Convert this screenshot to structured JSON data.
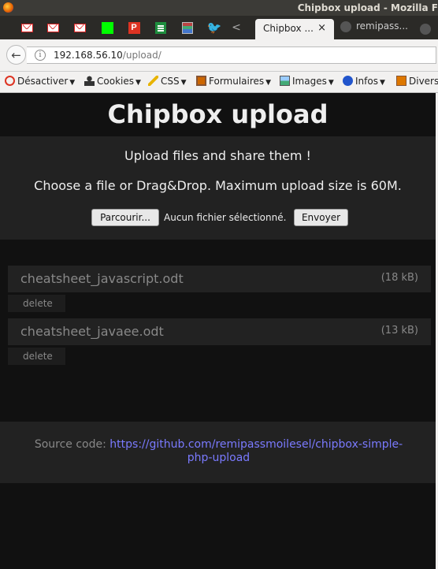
{
  "window": {
    "title": "Chipbox upload - Mozilla F"
  },
  "tabs": {
    "active": {
      "label": "Chipbox ...",
      "close": "×"
    },
    "second": {
      "label": "remipass..."
    },
    "overflow": "<"
  },
  "navbar": {
    "back": "←",
    "host": "192.168.56.10",
    "path": "/upload/",
    "info": "i"
  },
  "toolbar": [
    {
      "label": "Désactiver",
      "icon": "forbidden-icon",
      "color": "#d32"
    },
    {
      "label": "Cookies",
      "icon": "person-icon",
      "color": "#333"
    },
    {
      "label": "CSS",
      "icon": "pencil-icon",
      "color": "#e8b400"
    },
    {
      "label": "Formulaires",
      "icon": "clipboard-icon",
      "color": "#c60"
    },
    {
      "label": "Images",
      "icon": "image-icon",
      "color": "#4a7"
    },
    {
      "label": "Infos",
      "icon": "info-icon",
      "color": "#25c"
    },
    {
      "label": "Divers",
      "icon": "book-icon",
      "color": "#d70"
    }
  ],
  "page": {
    "heading": "Chipbox upload",
    "upload": {
      "line1": "Upload files and share them !",
      "line2": "Choose a file or Drag&Drop. Maximum upload size is 60M.",
      "browse": "Parcourir...",
      "no_file": "Aucun fichier sélectionné.",
      "submit": "Envoyer"
    },
    "files": [
      {
        "name": "cheatsheet_javascript.odt",
        "size": "(18 kB)",
        "delete": "delete"
      },
      {
        "name": "cheatsheet_javaee.odt",
        "size": "(13 kB)",
        "delete": "delete"
      }
    ],
    "footer": {
      "label": "Source code:",
      "link": "https://github.com/remipassmoilesel/chipbox-simple-php-upload"
    }
  }
}
